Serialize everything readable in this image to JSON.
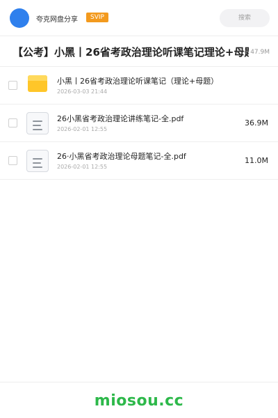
{
  "header": {
    "brand": "夸克网盘分享",
    "badge": "SVIP",
    "search_placeholder": "搜索"
  },
  "title": {
    "text": "【公考】小黑丨26省考政治理论听课笔记理论+母题",
    "size": "47.9M"
  },
  "files": [
    {
      "name": "小黑丨26省考政治理论听课笔记（理论+母题）",
      "date": "2026-03-03 21:44",
      "size": "",
      "icon": "folder-icon"
    },
    {
      "name": "26小黑省考政治理论讲练笔记-全.pdf",
      "date": "2026-02-01 12:55",
      "size": "36.9M",
      "icon": "document-icon"
    },
    {
      "name": "26·小黑省考政治理论母题笔记-全.pdf",
      "date": "2026-02-01 12:55",
      "size": "11.0M",
      "icon": "document-icon"
    }
  ],
  "footer": {
    "brand": "miosou.cc"
  },
  "colors": {
    "avatar": "#2f80ed",
    "badge": "#f39a1e",
    "folder": "#ffc629",
    "footer_brand": "#2db84a"
  }
}
